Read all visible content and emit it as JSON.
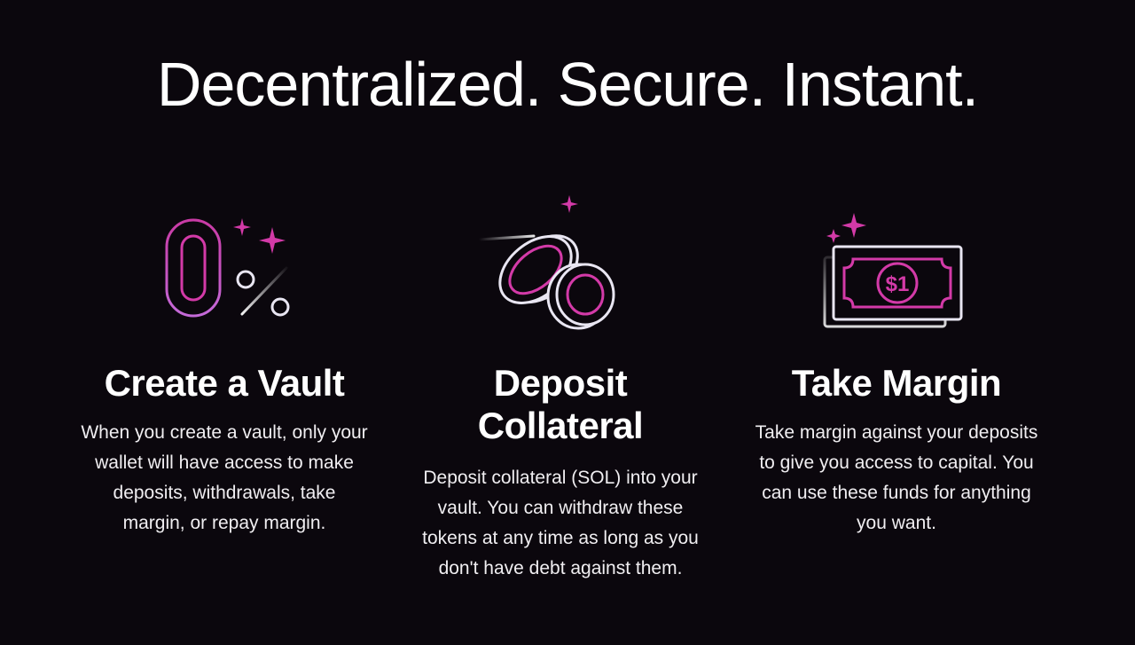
{
  "headline": "Decentralized. Secure. Instant.",
  "cards": [
    {
      "icon": "zero-percent-icon",
      "title": "Create a Vault",
      "body_lines": [
        "When you create a vault, only your",
        "wallet will have access to make",
        "deposits, withdrawals, take",
        "margin, or repay margin."
      ]
    },
    {
      "icon": "coins-icon",
      "title_lines": [
        "Deposit",
        "Collateral"
      ],
      "body_lines": [
        "Deposit collateral (SOL) into your",
        "vault. You can withdraw these",
        "tokens at any time as long as you",
        "don't have debt against them."
      ]
    },
    {
      "icon": "dollar-bill-icon",
      "title": "Take Margin",
      "body_lines": [
        "Take margin against your deposits",
        "to give you access to capital. You",
        "can use these funds for anything",
        "you want."
      ]
    }
  ],
  "colors": {
    "background": "#0b070d",
    "accent": "#d33aa8",
    "outline": "#e9e6f2"
  }
}
